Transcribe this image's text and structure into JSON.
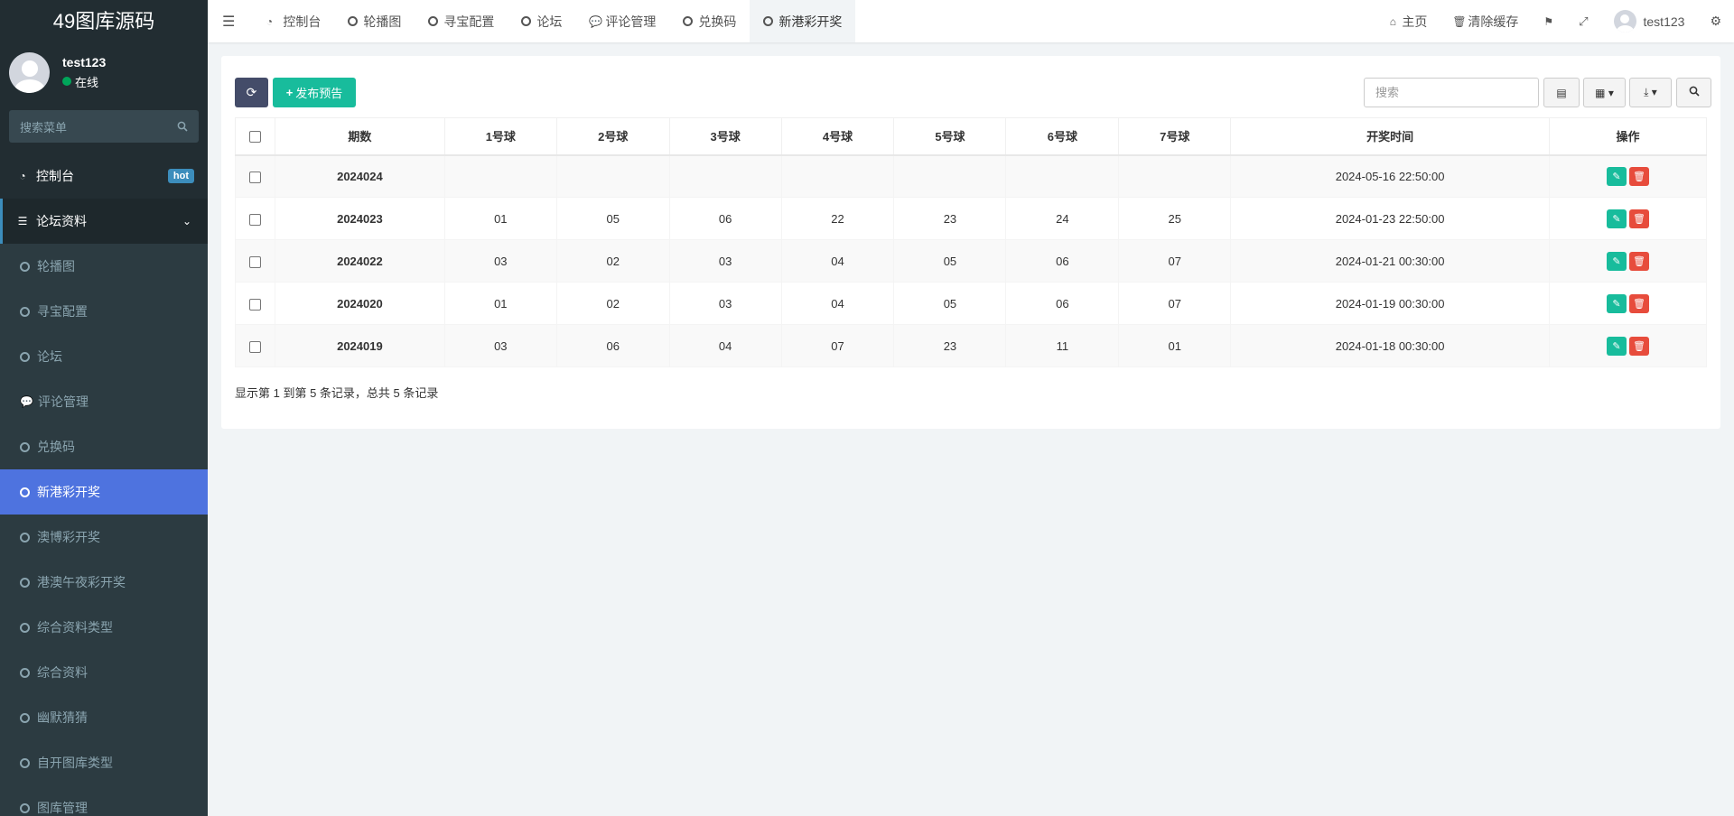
{
  "sidebar": {
    "logo": "49图库源码",
    "user": {
      "name": "test123",
      "status": "在线"
    },
    "search_placeholder": "搜索菜单",
    "dashboard": {
      "label": "控制台",
      "badge": "hot"
    },
    "group": {
      "label": "论坛资料"
    },
    "items": [
      {
        "label": "轮播图"
      },
      {
        "label": "寻宝配置"
      },
      {
        "label": "论坛"
      },
      {
        "label": "评论管理"
      },
      {
        "label": "兑换码"
      },
      {
        "label": "新港彩开奖"
      },
      {
        "label": "澳博彩开奖"
      },
      {
        "label": "港澳午夜彩开奖"
      },
      {
        "label": "综合资料类型"
      },
      {
        "label": "综合资料"
      },
      {
        "label": "幽默猜猜"
      },
      {
        "label": "自开图库类型"
      },
      {
        "label": "图库管理"
      }
    ]
  },
  "topnav": {
    "tabs": [
      {
        "label": "控制台"
      },
      {
        "label": "轮播图"
      },
      {
        "label": "寻宝配置"
      },
      {
        "label": "论坛"
      },
      {
        "label": "评论管理"
      },
      {
        "label": "兑换码"
      },
      {
        "label": "新港彩开奖"
      }
    ],
    "home": "主页",
    "clear_cache": "清除缓存",
    "username": "test123"
  },
  "toolbar": {
    "add_label": "发布预告",
    "search_placeholder": "搜索"
  },
  "table": {
    "headers": [
      "期数",
      "1号球",
      "2号球",
      "3号球",
      "4号球",
      "5号球",
      "6号球",
      "7号球",
      "开奖时间",
      "操作"
    ],
    "rows": [
      {
        "issue": "2024024",
        "balls": [
          "",
          "",
          "",
          "",
          "",
          "",
          ""
        ],
        "time": "2024-05-16 22:50:00"
      },
      {
        "issue": "2024023",
        "balls": [
          "01",
          "05",
          "06",
          "22",
          "23",
          "24",
          "25"
        ],
        "time": "2024-01-23 22:50:00"
      },
      {
        "issue": "2024022",
        "balls": [
          "03",
          "02",
          "03",
          "04",
          "05",
          "06",
          "07"
        ],
        "time": "2024-01-21 00:30:00"
      },
      {
        "issue": "2024020",
        "balls": [
          "01",
          "02",
          "03",
          "04",
          "05",
          "06",
          "07"
        ],
        "time": "2024-01-19 00:30:00"
      },
      {
        "issue": "2024019",
        "balls": [
          "03",
          "06",
          "04",
          "07",
          "23",
          "11",
          "01"
        ],
        "time": "2024-01-18 00:30:00"
      }
    ]
  },
  "summary": "显示第 1 到第 5 条记录，总共 5 条记录",
  "colors": {
    "sidebar_bg": "#222d32",
    "active_menu": "#4e73df",
    "primary_green": "#18bc9c",
    "danger": "#e74c3c",
    "issue_red": "#e40000"
  }
}
